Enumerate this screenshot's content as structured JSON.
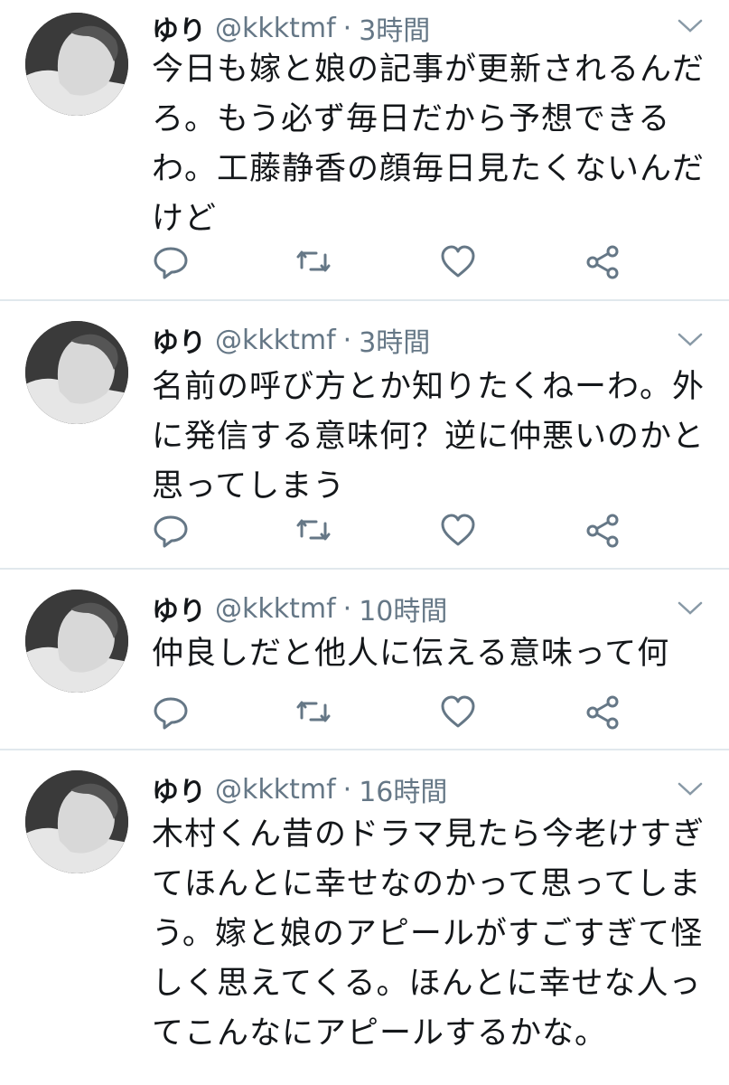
{
  "tweets": [
    {
      "name": "ゆり",
      "handle": "@kkktmf",
      "separator": "·",
      "time": "3時間",
      "text": "今日も嫁と娘の記事が更新されるんだろ。もう必ず毎日だから予想できるわ。工藤静香の顔毎日見たくないんだけど"
    },
    {
      "name": "ゆり",
      "handle": "@kkktmf",
      "separator": "·",
      "time": "3時間",
      "text": "名前の呼び方とか知りたくねーわ。外に発信する意味何？逆に仲悪いのかと思ってしまう"
    },
    {
      "name": "ゆり",
      "handle": "@kkktmf",
      "separator": "·",
      "time": "10時間",
      "text": "仲良しだと他人に伝える意味って何"
    },
    {
      "name": "ゆり",
      "handle": "@kkktmf",
      "separator": "·",
      "time": "16時間",
      "text": "木村くん昔のドラマ見たら今老けすぎてほんとに幸せなのかって思ってしまう。嫁と娘のアピールがすごすぎて怪しく思えてくる。ほんとに幸せな人ってこんなにアピールするかな。"
    }
  ],
  "icons": {
    "reply": "reply-icon",
    "retweet": "retweet-icon",
    "like": "heart-icon",
    "share": "share-icon",
    "menu": "chevron-down-icon"
  },
  "colors": {
    "text": "#14171a",
    "secondary": "#657786",
    "divider": "#e1e8ed"
  }
}
